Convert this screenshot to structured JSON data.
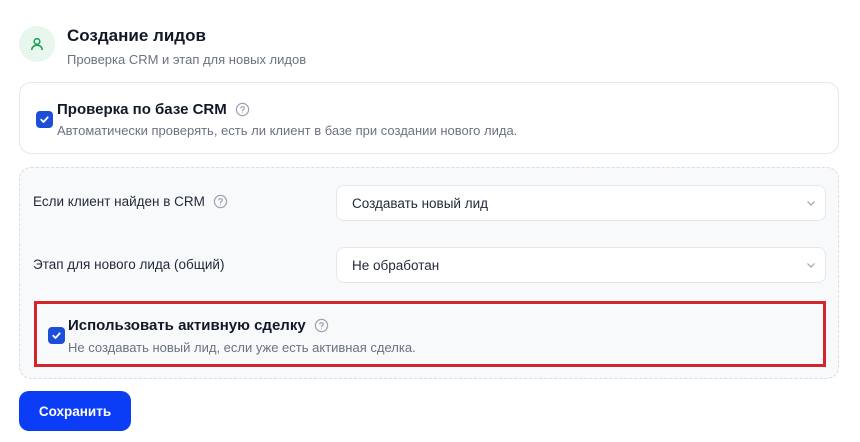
{
  "header": {
    "icon": "user-icon",
    "title": "Создание лидов",
    "subtitle": "Проверка CRM и этап для новых лидов"
  },
  "crm_check": {
    "checked": true,
    "title": "Проверка по базе CRM",
    "description": "Автоматически проверять, есть ли клиент в базе при создании нового лида."
  },
  "settings": {
    "client_found": {
      "label": "Если клиент найден в CRM",
      "value": "Создавать новый лид"
    },
    "new_lead_stage": {
      "label": "Этап для нового лида (общий)",
      "value": "Не обработан"
    },
    "active_deal": {
      "checked": true,
      "title": "Использовать активную сделку",
      "description": "Не создавать новый лид, если уже есть активная сделка."
    }
  },
  "actions": {
    "save_label": "Сохранить"
  },
  "colors": {
    "accent": "#0a3df5",
    "checkbox": "#1d4ed8",
    "highlight": "#d3262b",
    "icon_bg": "#e8f6ee",
    "icon_fg": "#22a05a"
  }
}
